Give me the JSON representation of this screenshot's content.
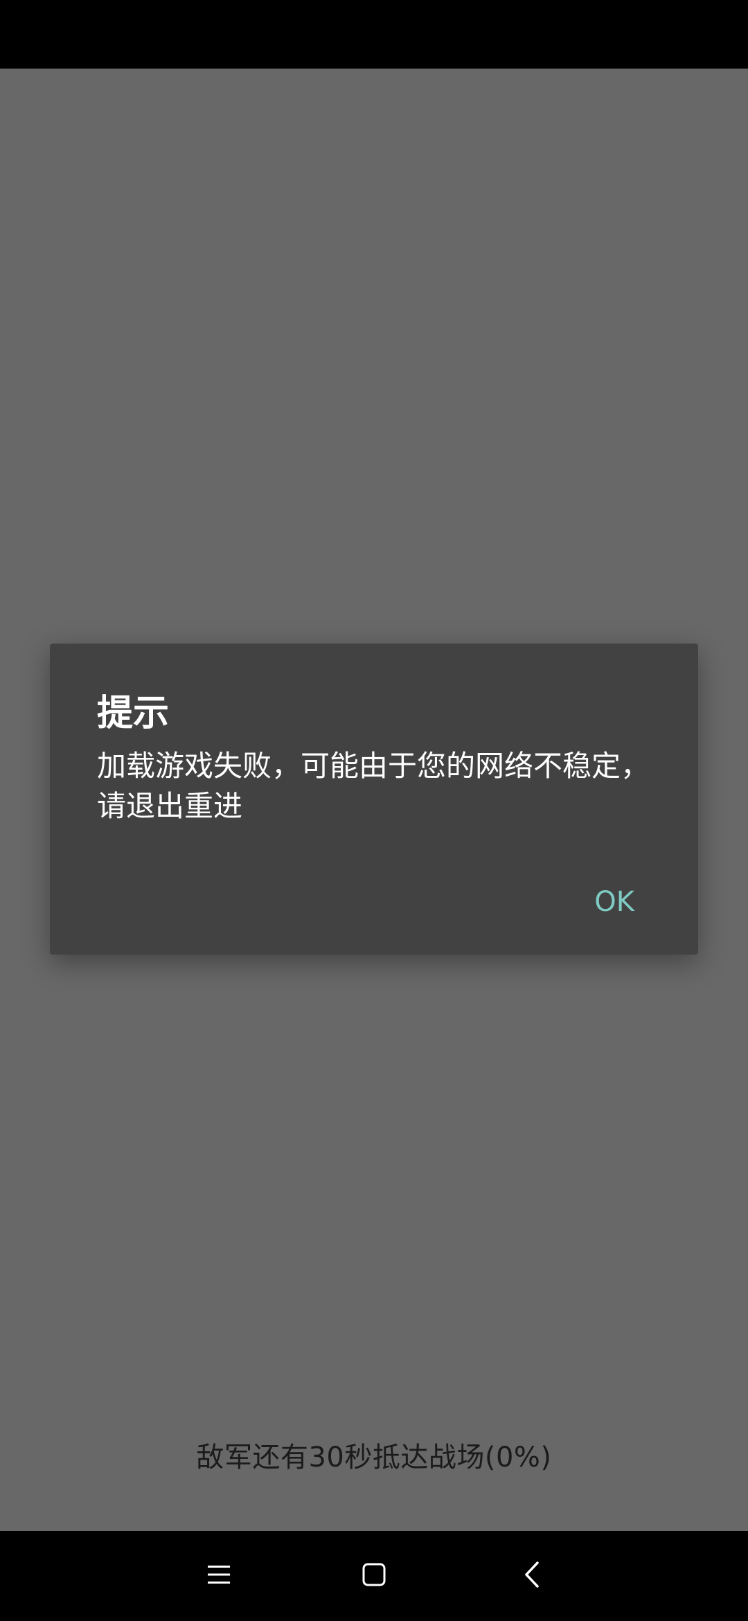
{
  "dialog": {
    "title": "提示",
    "message": "加载游戏失败，可能由于您的网络不稳定，请退出重进",
    "ok_label": "OK"
  },
  "loading": {
    "text": "敌军还有30秒抵达战场(0%)",
    "progress_percent": 0
  },
  "navigation": {
    "icons": [
      "menu-icon",
      "home-icon",
      "back-icon"
    ]
  },
  "colors": {
    "background": "#686868",
    "dialog": "#424242",
    "accent": "#7fcbc4"
  }
}
